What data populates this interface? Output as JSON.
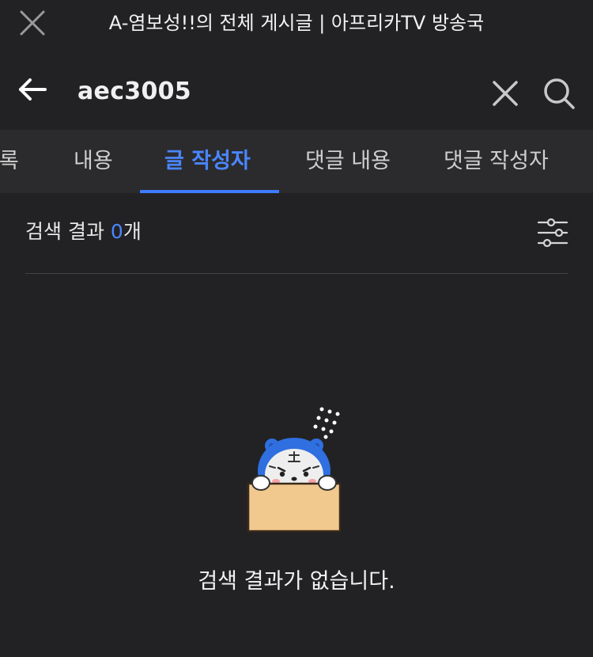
{
  "window": {
    "title": "A-염보성!!의 전체 게시글 | 아프리카TV 방송국"
  },
  "search": {
    "query": "aec3005"
  },
  "tabs": [
    {
      "label": "목록"
    },
    {
      "label": "내용"
    },
    {
      "label": "글 작성자"
    },
    {
      "label": "댓글 내용"
    },
    {
      "label": "댓글 작성자"
    }
  ],
  "results": {
    "label_prefix": "검색 결과 ",
    "count": "0",
    "label_suffix": "개"
  },
  "empty": {
    "message": "검색 결과가 없습니다."
  },
  "colors": {
    "background": "#222224",
    "tab_bar": "#2b2b2d",
    "accent": "#3d7bff",
    "text": "#ffffff",
    "mascot_blue": "#2f6fe0",
    "box": "#f1c98e"
  }
}
